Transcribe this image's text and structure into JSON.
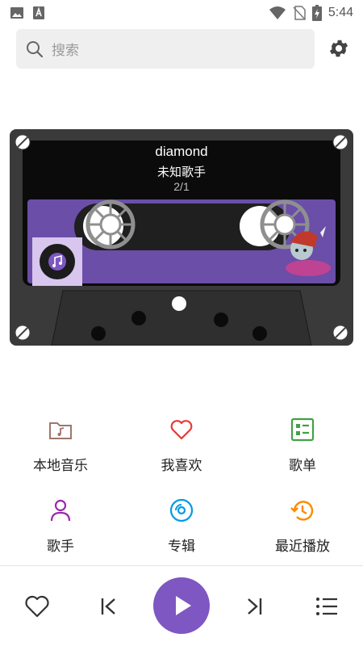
{
  "status_bar": {
    "time": "5:44",
    "icons": [
      "image-icon",
      "text-icon",
      "wifi-icon",
      "no-sim-icon",
      "battery-icon"
    ]
  },
  "search": {
    "placeholder": "搜索"
  },
  "settings": {
    "icon": "gear-icon"
  },
  "now_playing": {
    "title": "diamond",
    "artist": "未知歌手",
    "track_index": "2/1"
  },
  "menu": [
    {
      "label": "本地音乐",
      "icon": "folder-music-icon",
      "color": "#a0766a"
    },
    {
      "label": "我喜欢",
      "icon": "heart-icon",
      "color": "#e53935"
    },
    {
      "label": "歌单",
      "icon": "playlist-icon",
      "color": "#43a047"
    },
    {
      "label": "歌手",
      "icon": "person-icon",
      "color": "#9c27b0"
    },
    {
      "label": "专辑",
      "icon": "album-disc-icon",
      "color": "#039be5"
    },
    {
      "label": "最近播放",
      "icon": "history-icon",
      "color": "#fb8c00"
    }
  ],
  "player_controls": {
    "favorite": "heart-outline-icon",
    "previous": "skip-previous-icon",
    "play": "play-icon",
    "next": "skip-next-icon",
    "queue": "queue-list-icon",
    "accent": "#7e57c2"
  }
}
